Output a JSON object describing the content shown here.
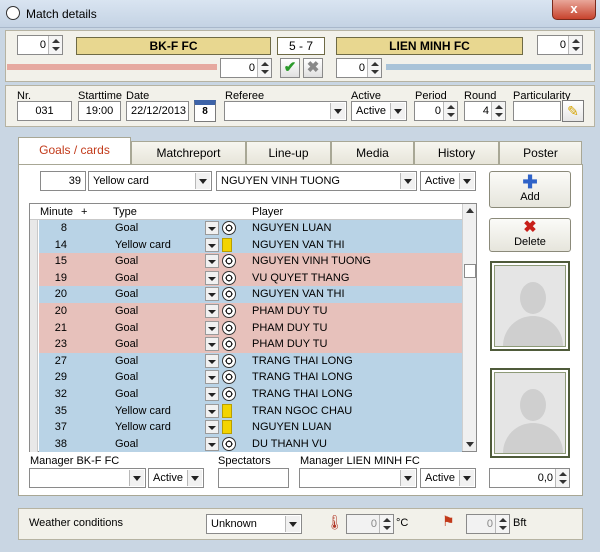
{
  "window": {
    "title": "Match details",
    "close": "x"
  },
  "score": {
    "home_spin": "0",
    "away_spin": "0",
    "home_team": "BK-F FC",
    "away_team": "LIEN MINH FC",
    "result": "5  - 7",
    "home_sub_spin": "0",
    "away_sub_spin": "0"
  },
  "info": {
    "nr_label": "Nr.",
    "nr": "031",
    "starttime_label": "Starttime",
    "starttime": "19:00",
    "date_label": "Date",
    "date": "22/12/2013",
    "calendar_badge": "8",
    "referee_label": "Referee",
    "referee": "",
    "active_label": "Active",
    "active": "Active",
    "period_label": "Period",
    "period": "0",
    "round_label": "Round",
    "round": "4",
    "particularity_label": "Particularity",
    "particularity": ""
  },
  "tabs": [
    "Goals / cards",
    "Matchreport",
    "Line-up",
    "Media",
    "History",
    "Poster"
  ],
  "event_editor": {
    "minute": "39",
    "type": "Yellow card",
    "player": "NGUYEN VINH TUONG",
    "status": "Active"
  },
  "buttons": {
    "add": "Add",
    "delete": "Delete"
  },
  "grid": {
    "headers": {
      "minute": "Minute",
      "plus": "+",
      "type": "Type",
      "player": "Player"
    },
    "rows": [
      {
        "minute": "8",
        "type": "Goal",
        "player": "NGUYEN LUAN",
        "team": "away",
        "icon": "ball-icon"
      },
      {
        "minute": "14",
        "type": "Yellow card",
        "player": "NGUYEN VAN THI",
        "team": "away",
        "icon": "yellow-card-icon"
      },
      {
        "minute": "15",
        "type": "Goal",
        "player": "NGUYEN VINH TUONG",
        "team": "home",
        "icon": "ball-icon"
      },
      {
        "minute": "19",
        "type": "Goal",
        "player": "VU QUYET THANG",
        "team": "home",
        "icon": "ball-icon"
      },
      {
        "minute": "20",
        "type": "Goal",
        "player": "NGUYEN VAN THI",
        "team": "away",
        "icon": "ball-icon"
      },
      {
        "minute": "20",
        "type": "Goal",
        "player": "PHAM DUY TU",
        "team": "home",
        "icon": "ball-icon"
      },
      {
        "minute": "21",
        "type": "Goal",
        "player": "PHAM DUY TU",
        "team": "home",
        "icon": "ball-icon"
      },
      {
        "minute": "23",
        "type": "Goal",
        "player": "PHAM DUY TU",
        "team": "home",
        "icon": "ball-icon"
      },
      {
        "minute": "27",
        "type": "Goal",
        "player": "TRANG THAI LONG",
        "team": "away",
        "icon": "ball-icon"
      },
      {
        "minute": "29",
        "type": "Goal",
        "player": "TRANG THAI LONG",
        "team": "away",
        "icon": "ball-icon"
      },
      {
        "minute": "32",
        "type": "Goal",
        "player": "TRANG THAI LONG",
        "team": "away",
        "icon": "ball-icon"
      },
      {
        "minute": "35",
        "type": "Yellow card",
        "player": "TRAN NGOC CHAU",
        "team": "away",
        "icon": "yellow-card-icon"
      },
      {
        "minute": "37",
        "type": "Yellow card",
        "player": "NGUYEN LUAN",
        "team": "away",
        "icon": "yellow-card-icon"
      },
      {
        "minute": "38",
        "type": "Goal",
        "player": "DU THANH VU",
        "team": "away",
        "icon": "ball-icon"
      }
    ]
  },
  "footer": {
    "manager_home_label": "Manager BK-F FC",
    "manager_home": "",
    "manager_home_status": "Active",
    "spectators_label": "Spectators",
    "spectators": "",
    "manager_away_label": "Manager LIEN MINH FC",
    "manager_away": "",
    "manager_away_status": "Active",
    "rating": "0,0"
  },
  "weather": {
    "label": "Weather conditions",
    "condition": "Unknown",
    "temp": "0",
    "temp_unit": "°C",
    "wind": "0",
    "wind_unit": "Bft"
  },
  "colors": {
    "home_row": "#e7c1bb",
    "away_row": "#b9d3e6",
    "team_bar": "#e8d790",
    "active_tab_text": "#c23a1a"
  }
}
